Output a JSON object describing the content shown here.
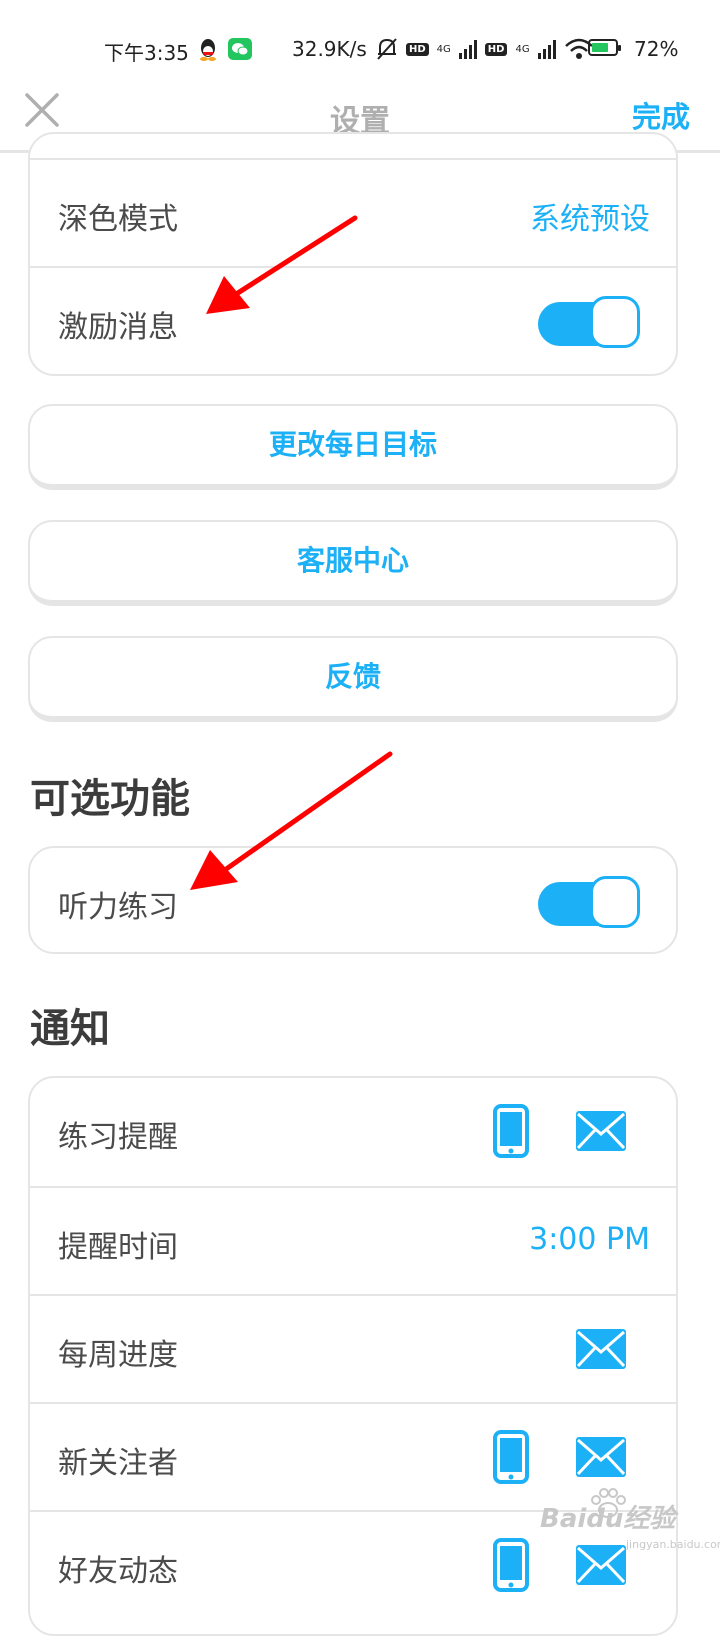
{
  "status_bar": {
    "time": "下午3:35",
    "speed": "32.9K/s",
    "net1": "4G",
    "net2": "4G",
    "hd": "HD",
    "battery": "72%",
    "battery_level": 0.72
  },
  "header": {
    "title": "设置",
    "done_label": "完成"
  },
  "settings_card": {
    "rows": [
      {
        "label": "深色模式",
        "value": "系统预设"
      },
      {
        "label": "激励消息",
        "toggle_on": true
      }
    ]
  },
  "buttons": {
    "daily_goal": "更改每日目标",
    "support": "客服中心",
    "feedback": "反馈"
  },
  "optional_features": {
    "title": "可选功能",
    "rows": [
      {
        "label": "听力练习",
        "toggle_on": true
      }
    ]
  },
  "notifications": {
    "title": "通知",
    "rows": [
      {
        "label": "练习提醒",
        "icons": [
          "phone-icon",
          "mail-icon"
        ]
      },
      {
        "label": "提醒时间",
        "value": "3:00 PM"
      },
      {
        "label": "每周进度",
        "icons": [
          "mail-icon"
        ]
      },
      {
        "label": "新关注者",
        "icons": [
          "phone-icon",
          "mail-icon"
        ]
      },
      {
        "label": "好友动态",
        "icons": [
          "phone-icon",
          "mail-icon"
        ]
      }
    ]
  },
  "watermark": {
    "brand": "Baidu经验",
    "sub": "jingyan.baidu.com"
  },
  "colors": {
    "accent": "#1cb0f6",
    "border": "#e5e5e5",
    "text": "#4b4b4b",
    "arrow": "#ff0000"
  }
}
